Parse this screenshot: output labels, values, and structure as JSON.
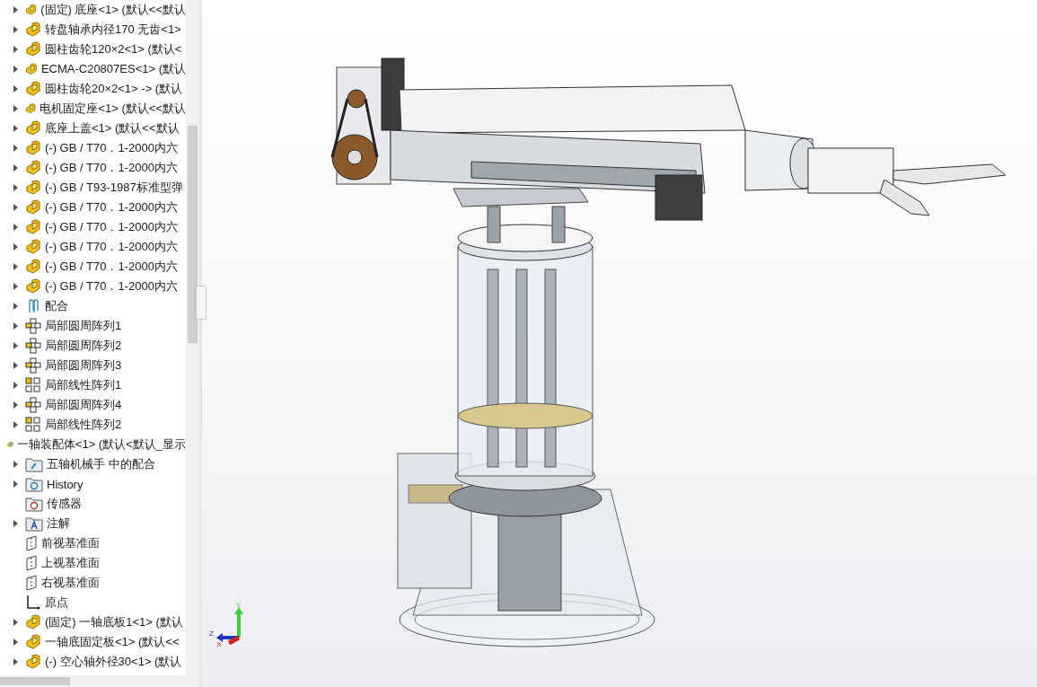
{
  "tree": {
    "continued_children": [
      {
        "label": "(固定) 底座<1> (默认<<默认",
        "kind": "part",
        "expandable": true
      },
      {
        "label": "转盘轴承内径170 无齿<1>",
        "kind": "part",
        "expandable": true
      },
      {
        "label": "圆柱齿轮120×2<1> (默认<",
        "kind": "part",
        "expandable": true
      },
      {
        "label": "ECMA-C20807ES<1> (默认",
        "kind": "part",
        "expandable": true
      },
      {
        "label": "圆柱齿轮20×2<1> -> (默认",
        "kind": "part",
        "expandable": true
      },
      {
        "label": "电机固定座<1> (默认<<默认",
        "kind": "part",
        "expandable": true
      },
      {
        "label": "底座上盖<1> (默认<<默认",
        "kind": "part",
        "expandable": true
      },
      {
        "label": "(-) GB / T70．1-2000内六",
        "kind": "part",
        "expandable": true
      },
      {
        "label": "(-) GB / T70．1-2000内六",
        "kind": "part",
        "expandable": true
      },
      {
        "label": "(-) GB / T93-1987标准型弹",
        "kind": "part",
        "expandable": true
      },
      {
        "label": "(-) GB / T70．1-2000内六",
        "kind": "part",
        "expandable": true
      },
      {
        "label": "(-) GB / T70．1-2000内六",
        "kind": "part",
        "expandable": true
      },
      {
        "label": "(-) GB / T70．1-2000内六",
        "kind": "part",
        "expandable": true
      },
      {
        "label": "(-) GB / T70．1-2000内六",
        "kind": "part",
        "expandable": true
      },
      {
        "label": "(-) GB / T70．1-2000内六",
        "kind": "part",
        "expandable": true
      },
      {
        "label": "配合",
        "kind": "mates",
        "expandable": true
      },
      {
        "label": "局部圆周阵列1",
        "kind": "circular-pattern",
        "expandable": true
      },
      {
        "label": "局部圆周阵列2",
        "kind": "circular-pattern",
        "expandable": true
      },
      {
        "label": "局部圆周阵列3",
        "kind": "circular-pattern",
        "expandable": true
      },
      {
        "label": "局部线性阵列1",
        "kind": "linear-pattern",
        "expandable": true
      },
      {
        "label": "局部圆周阵列4",
        "kind": "circular-pattern",
        "expandable": true
      },
      {
        "label": "局部线性阵列2",
        "kind": "linear-pattern",
        "expandable": true
      }
    ],
    "nodes": [
      {
        "label": "一轴装配体<1> (默认<默认_显示",
        "kind": "assembly",
        "expandable": false,
        "children": [
          {
            "label": "五轴机械手 中的配合",
            "kind": "folder-mates",
            "expandable": true
          },
          {
            "label": "History",
            "kind": "folder-history",
            "expandable": true
          },
          {
            "label": "传感器",
            "kind": "folder-sensor",
            "expandable": false
          },
          {
            "label": "注解",
            "kind": "folder-annotation",
            "expandable": true
          },
          {
            "label": "前视基准面",
            "kind": "plane",
            "expandable": false
          },
          {
            "label": "上视基准面",
            "kind": "plane",
            "expandable": false
          },
          {
            "label": "右视基准面",
            "kind": "plane",
            "expandable": false
          },
          {
            "label": "原点",
            "kind": "origin",
            "expandable": false
          },
          {
            "label": "(固定) 一轴底板1<1> (默认",
            "kind": "part",
            "expandable": true
          },
          {
            "label": "一轴底固定板<1> (默认<<",
            "kind": "part",
            "expandable": true
          },
          {
            "label": "(-) 空心轴外径30<1> (默认",
            "kind": "part",
            "expandable": true
          }
        ]
      }
    ]
  },
  "triad": {
    "x": "X",
    "y": "Y",
    "z": "Z"
  }
}
